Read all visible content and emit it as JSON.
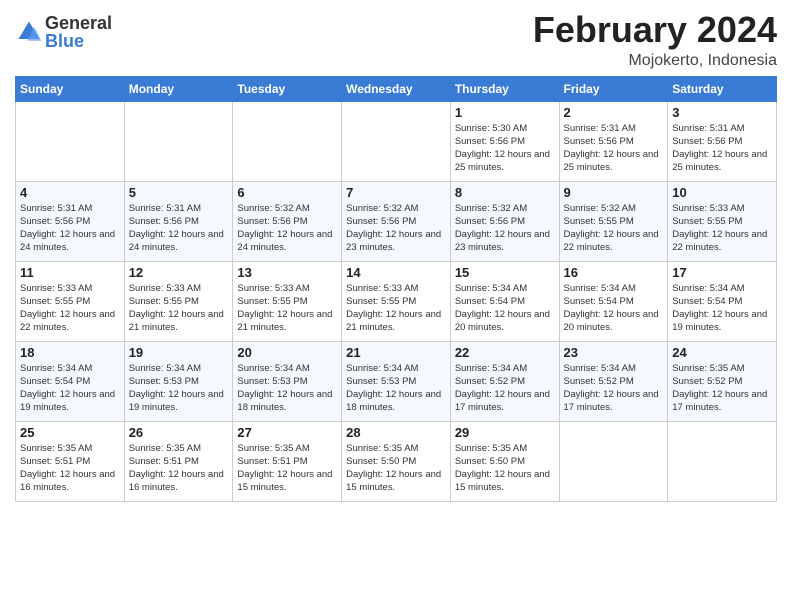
{
  "logo": {
    "general": "General",
    "blue": "Blue"
  },
  "title": "February 2024",
  "subtitle": "Mojokerto, Indonesia",
  "days_of_week": [
    "Sunday",
    "Monday",
    "Tuesday",
    "Wednesday",
    "Thursday",
    "Friday",
    "Saturday"
  ],
  "weeks": [
    [
      {
        "day": "",
        "info": ""
      },
      {
        "day": "",
        "info": ""
      },
      {
        "day": "",
        "info": ""
      },
      {
        "day": "",
        "info": ""
      },
      {
        "day": "1",
        "info": "Sunrise: 5:30 AM\nSunset: 5:56 PM\nDaylight: 12 hours and 25 minutes."
      },
      {
        "day": "2",
        "info": "Sunrise: 5:31 AM\nSunset: 5:56 PM\nDaylight: 12 hours and 25 minutes."
      },
      {
        "day": "3",
        "info": "Sunrise: 5:31 AM\nSunset: 5:56 PM\nDaylight: 12 hours and 25 minutes."
      }
    ],
    [
      {
        "day": "4",
        "info": "Sunrise: 5:31 AM\nSunset: 5:56 PM\nDaylight: 12 hours and 24 minutes."
      },
      {
        "day": "5",
        "info": "Sunrise: 5:31 AM\nSunset: 5:56 PM\nDaylight: 12 hours and 24 minutes."
      },
      {
        "day": "6",
        "info": "Sunrise: 5:32 AM\nSunset: 5:56 PM\nDaylight: 12 hours and 24 minutes."
      },
      {
        "day": "7",
        "info": "Sunrise: 5:32 AM\nSunset: 5:56 PM\nDaylight: 12 hours and 23 minutes."
      },
      {
        "day": "8",
        "info": "Sunrise: 5:32 AM\nSunset: 5:56 PM\nDaylight: 12 hours and 23 minutes."
      },
      {
        "day": "9",
        "info": "Sunrise: 5:32 AM\nSunset: 5:55 PM\nDaylight: 12 hours and 22 minutes."
      },
      {
        "day": "10",
        "info": "Sunrise: 5:33 AM\nSunset: 5:55 PM\nDaylight: 12 hours and 22 minutes."
      }
    ],
    [
      {
        "day": "11",
        "info": "Sunrise: 5:33 AM\nSunset: 5:55 PM\nDaylight: 12 hours and 22 minutes."
      },
      {
        "day": "12",
        "info": "Sunrise: 5:33 AM\nSunset: 5:55 PM\nDaylight: 12 hours and 21 minutes."
      },
      {
        "day": "13",
        "info": "Sunrise: 5:33 AM\nSunset: 5:55 PM\nDaylight: 12 hours and 21 minutes."
      },
      {
        "day": "14",
        "info": "Sunrise: 5:33 AM\nSunset: 5:55 PM\nDaylight: 12 hours and 21 minutes."
      },
      {
        "day": "15",
        "info": "Sunrise: 5:34 AM\nSunset: 5:54 PM\nDaylight: 12 hours and 20 minutes."
      },
      {
        "day": "16",
        "info": "Sunrise: 5:34 AM\nSunset: 5:54 PM\nDaylight: 12 hours and 20 minutes."
      },
      {
        "day": "17",
        "info": "Sunrise: 5:34 AM\nSunset: 5:54 PM\nDaylight: 12 hours and 19 minutes."
      }
    ],
    [
      {
        "day": "18",
        "info": "Sunrise: 5:34 AM\nSunset: 5:54 PM\nDaylight: 12 hours and 19 minutes."
      },
      {
        "day": "19",
        "info": "Sunrise: 5:34 AM\nSunset: 5:53 PM\nDaylight: 12 hours and 19 minutes."
      },
      {
        "day": "20",
        "info": "Sunrise: 5:34 AM\nSunset: 5:53 PM\nDaylight: 12 hours and 18 minutes."
      },
      {
        "day": "21",
        "info": "Sunrise: 5:34 AM\nSunset: 5:53 PM\nDaylight: 12 hours and 18 minutes."
      },
      {
        "day": "22",
        "info": "Sunrise: 5:34 AM\nSunset: 5:52 PM\nDaylight: 12 hours and 17 minutes."
      },
      {
        "day": "23",
        "info": "Sunrise: 5:34 AM\nSunset: 5:52 PM\nDaylight: 12 hours and 17 minutes."
      },
      {
        "day": "24",
        "info": "Sunrise: 5:35 AM\nSunset: 5:52 PM\nDaylight: 12 hours and 17 minutes."
      }
    ],
    [
      {
        "day": "25",
        "info": "Sunrise: 5:35 AM\nSunset: 5:51 PM\nDaylight: 12 hours and 16 minutes."
      },
      {
        "day": "26",
        "info": "Sunrise: 5:35 AM\nSunset: 5:51 PM\nDaylight: 12 hours and 16 minutes."
      },
      {
        "day": "27",
        "info": "Sunrise: 5:35 AM\nSunset: 5:51 PM\nDaylight: 12 hours and 15 minutes."
      },
      {
        "day": "28",
        "info": "Sunrise: 5:35 AM\nSunset: 5:50 PM\nDaylight: 12 hours and 15 minutes."
      },
      {
        "day": "29",
        "info": "Sunrise: 5:35 AM\nSunset: 5:50 PM\nDaylight: 12 hours and 15 minutes."
      },
      {
        "day": "",
        "info": ""
      },
      {
        "day": "",
        "info": ""
      }
    ]
  ]
}
